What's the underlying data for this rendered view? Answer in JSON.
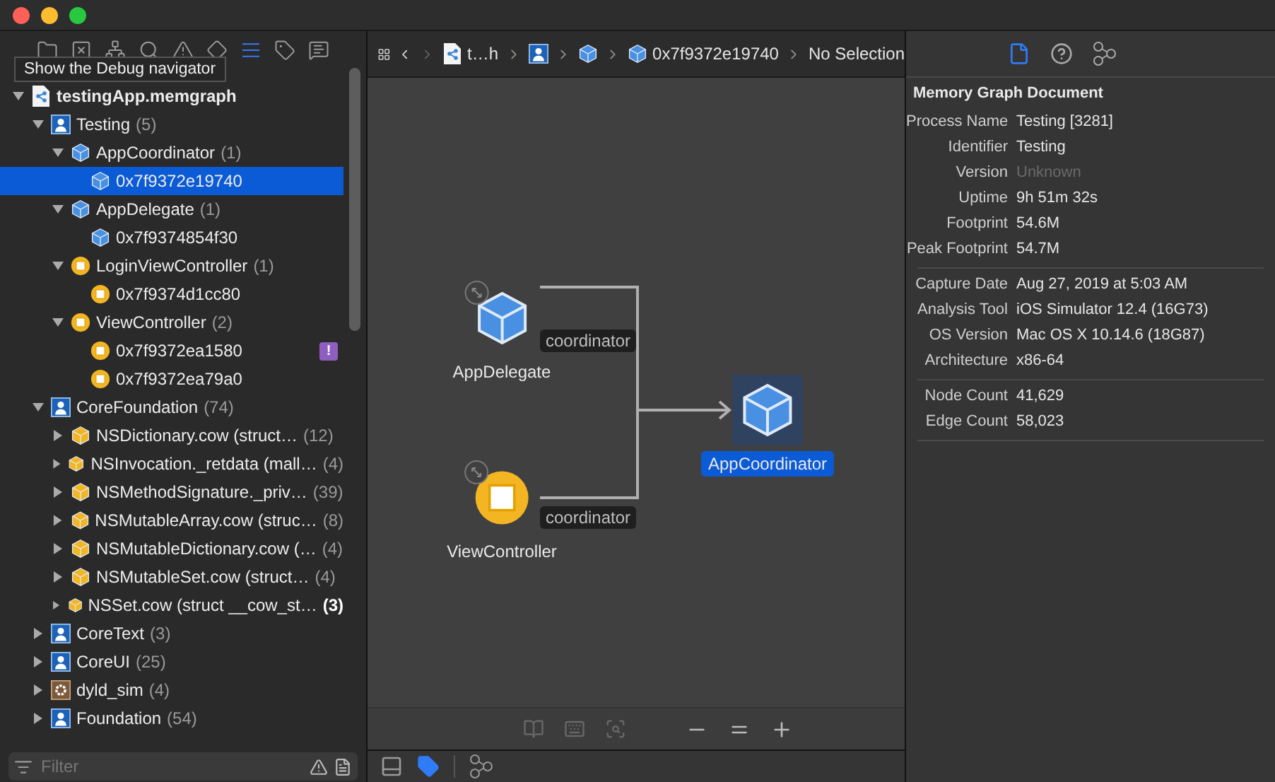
{
  "navigator": {
    "tabs": [
      {
        "kind": "folder",
        "selected": false
      },
      {
        "kind": "xbox",
        "selected": false
      },
      {
        "kind": "hierarchy",
        "selected": false
      },
      {
        "kind": "search",
        "selected": false
      },
      {
        "kind": "warning",
        "selected": false
      },
      {
        "kind": "diamond",
        "selected": false
      },
      {
        "kind": "debug",
        "selected": true
      },
      {
        "kind": "tag",
        "selected": false
      },
      {
        "kind": "message",
        "selected": false
      }
    ],
    "tooltip": "Show the Debug navigator",
    "tree": [
      {
        "kind": "file",
        "name": "testingApp.memgraph",
        "expanded": true,
        "selected": false,
        "children": [
          {
            "kind": "library",
            "name": "Testing",
            "count": "(5)",
            "expanded": true,
            "selected": false,
            "children": [
              {
                "kind": "cube",
                "name": "AppCoordinator",
                "count": "(1)",
                "expanded": true,
                "selected": false,
                "children": [
                  {
                    "kind": "cube",
                    "name": "0x7f9372e19740",
                    "selected": true
                  }
                ]
              },
              {
                "kind": "cube",
                "name": "AppDelegate",
                "count": "(1)",
                "expanded": true,
                "selected": false,
                "children": [
                  {
                    "kind": "cube",
                    "name": "0x7f9374854f30",
                    "selected": false
                  }
                ]
              },
              {
                "kind": "object",
                "name": "LoginViewController",
                "count": "(1)",
                "expanded": true,
                "selected": false,
                "children": [
                  {
                    "kind": "object",
                    "name": "0x7f9374d1cc80",
                    "selected": false
                  }
                ]
              },
              {
                "kind": "object",
                "name": "ViewController",
                "count": "(2)",
                "expanded": true,
                "selected": false,
                "children": [
                  {
                    "kind": "object",
                    "name": "0x7f9372ea1580",
                    "badge": "!",
                    "selected": false
                  },
                  {
                    "kind": "object",
                    "name": "0x7f9372ea79a0",
                    "selected": false
                  }
                ]
              }
            ]
          },
          {
            "kind": "library",
            "name": "CoreFoundation",
            "count": "(74)",
            "expanded": true,
            "selected": false,
            "children": [
              {
                "kind": "struct",
                "name": "NSDictionary.cow (struct…",
                "count": "(12)",
                "bold": false,
                "expanded": false,
                "selected": false
              },
              {
                "kind": "struct",
                "name": "NSInvocation._retdata (mall…",
                "count": "(4)",
                "bold": false,
                "expanded": false,
                "selected": false
              },
              {
                "kind": "struct",
                "name": "NSMethodSignature._priv…",
                "count": "(39)",
                "bold": false,
                "expanded": false,
                "selected": false
              },
              {
                "kind": "struct",
                "name": "NSMutableArray.cow (struc…",
                "count": "(8)",
                "bold": false,
                "expanded": false,
                "selected": false
              },
              {
                "kind": "struct",
                "name": "NSMutableDictionary.cow (…",
                "count": "(4)",
                "bold": false,
                "expanded": false,
                "selected": false
              },
              {
                "kind": "struct",
                "name": "NSMutableSet.cow (struct…",
                "count": "(4)",
                "bold": false,
                "expanded": false,
                "selected": false
              },
              {
                "kind": "struct",
                "name": "NSSet.cow (struct __cow_st…",
                "count": "(3)",
                "bold": true,
                "expanded": false,
                "selected": false
              }
            ]
          },
          {
            "kind": "library",
            "name": "CoreText",
            "count": "(3)",
            "expanded": false,
            "selected": false
          },
          {
            "kind": "library",
            "name": "CoreUI",
            "count": "(25)",
            "expanded": false,
            "selected": false
          },
          {
            "kind": "gear",
            "name": "dyld_sim",
            "count": "(4)",
            "expanded": false,
            "selected": false
          },
          {
            "kind": "library",
            "name": "Foundation",
            "count": "(54)",
            "expanded": false,
            "selected": false
          }
        ]
      }
    ],
    "filter": {
      "placeholder": "Filter"
    }
  },
  "jump_bar": {
    "items": [
      {
        "kind": "file",
        "text": "t…h"
      },
      {
        "kind": "library"
      },
      {
        "kind": "cube"
      },
      {
        "kind": "cube",
        "text": "0x7f9372e19740"
      },
      {
        "kind": "plain",
        "text": "No Selection"
      }
    ]
  },
  "graph": {
    "nodes": [
      {
        "kind": "cube",
        "label": "AppDelegate",
        "expandable": true,
        "selected": false
      },
      {
        "kind": "object",
        "label": "ViewController",
        "expandable": true,
        "selected": false
      },
      {
        "kind": "cube",
        "label": "AppCoordinator",
        "expandable": false,
        "selected": true
      }
    ],
    "edges": [
      {
        "label": "coordinator"
      },
      {
        "label": "coordinator"
      }
    ]
  },
  "inspector": {
    "tabs": [
      {
        "kind": "file",
        "selected": true
      },
      {
        "kind": "help",
        "selected": false
      },
      {
        "kind": "graph",
        "selected": false
      }
    ],
    "title": "Memory Graph Document",
    "sections": [
      [
        {
          "key": "Process Name",
          "value": "Testing [3281]",
          "dimmed": false
        },
        {
          "key": "Identifier",
          "value": "Testing",
          "dimmed": false
        },
        {
          "key": "Version",
          "value": "Unknown",
          "dimmed": true
        },
        {
          "key": "Uptime",
          "value": "9h 51m 32s",
          "dimmed": false
        },
        {
          "key": "Footprint",
          "value": "54.6M",
          "dimmed": false
        },
        {
          "key": "Peak Footprint",
          "value": "54.7M",
          "dimmed": false
        }
      ],
      [
        {
          "key": "Capture Date",
          "value": "Aug 27, 2019 at 5:03 AM",
          "dimmed": false
        },
        {
          "key": "Analysis Tool",
          "value": "iOS Simulator 12.4 (16G73)",
          "dimmed": false
        },
        {
          "key": "OS Version",
          "value": "Mac OS X 10.14.6 (18G87)",
          "dimmed": false
        },
        {
          "key": "Architecture",
          "value": "x86-64",
          "dimmed": false
        }
      ],
      [
        {
          "key": "Node Count",
          "value": "41,629",
          "dimmed": false
        },
        {
          "key": "Edge Count",
          "value": "58,023",
          "dimmed": false
        }
      ]
    ]
  },
  "debug_bar": {
    "tabs": [
      {
        "kind": "panel",
        "selected": false
      },
      {
        "kind": "tag",
        "selected": true
      },
      {
        "kind": "graph",
        "selected": false
      }
    ]
  }
}
